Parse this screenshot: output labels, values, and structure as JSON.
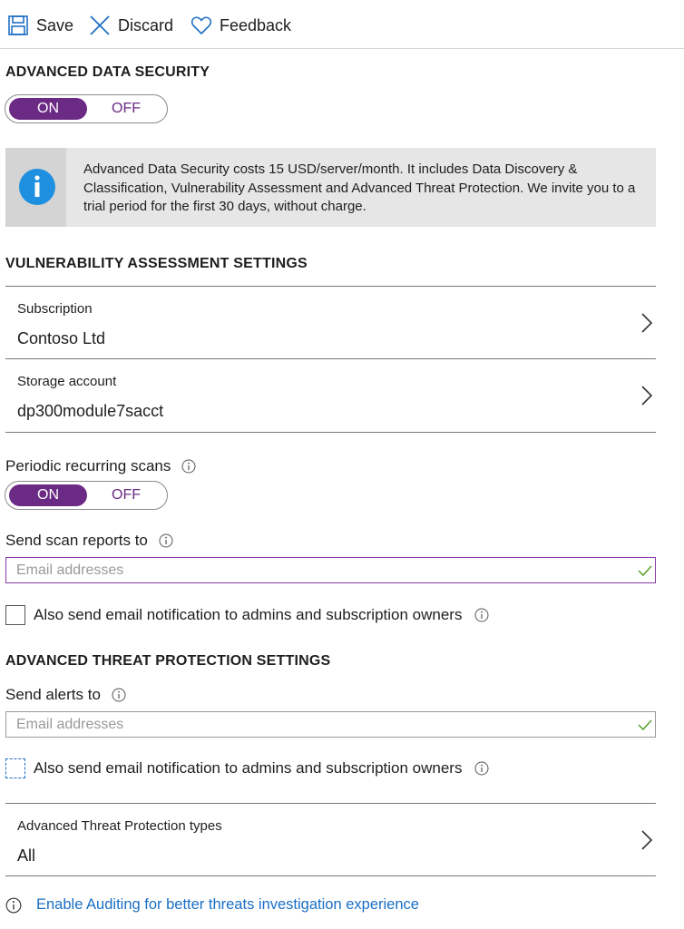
{
  "toolbar": {
    "save_label": "Save",
    "discard_label": "Discard",
    "feedback_label": "Feedback"
  },
  "ads": {
    "title": "ADVANCED DATA SECURITY",
    "toggle_on": "ON",
    "toggle_off": "OFF",
    "state": "ON",
    "info_text": "Advanced Data Security costs 15 USD/server/month. It includes Data Discovery & Classification, Vulnerability Assessment and Advanced Threat Protection. We invite you to a trial period for the first 30 days, without charge."
  },
  "va": {
    "title": "VULNERABILITY ASSESSMENT SETTINGS",
    "subscription_label": "Subscription",
    "subscription_value": "Contoso Ltd",
    "storage_label": "Storage account",
    "storage_value": "dp300module7sacct",
    "periodic_label": "Periodic recurring scans",
    "periodic_on": "ON",
    "periodic_off": "OFF",
    "periodic_state": "ON",
    "send_reports_label": "Send scan reports to",
    "email_placeholder": "Email addresses",
    "email_value": "",
    "also_send_label": "Also send email notification to admins and subscription owners",
    "also_send_checked": false
  },
  "atp": {
    "title": "ADVANCED THREAT PROTECTION SETTINGS",
    "send_alerts_label": "Send alerts to",
    "email_placeholder": "Email addresses",
    "email_value": "",
    "also_send_label": "Also send email notification to admins and subscription owners",
    "also_send_checked": false,
    "types_label": "Advanced Threat Protection types",
    "types_value": "All"
  },
  "footer": {
    "link_text": "Enable Auditing for better threats investigation experience"
  },
  "colors": {
    "accent_purple": "#6b2a84",
    "link_blue": "#1a6fc5",
    "icon_blue": "#1f6fc5",
    "valid_green": "#5aa02c"
  },
  "icons": {
    "save": "save-icon",
    "discard": "close-icon",
    "feedback": "heart-icon",
    "info": "info-icon",
    "chevron": "chevron-right-icon",
    "valid": "checkmark-icon"
  }
}
